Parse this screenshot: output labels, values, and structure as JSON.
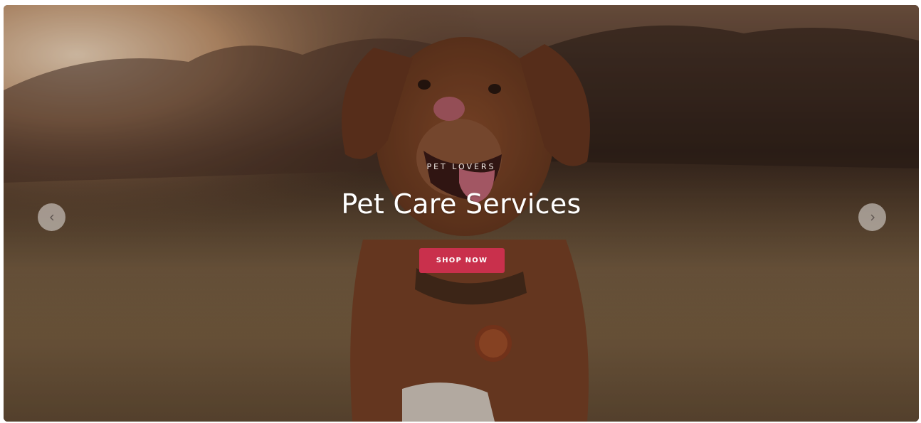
{
  "hero": {
    "eyebrow": "PET LOVERS",
    "title": "Pet Care Services",
    "cta_label": "SHOP NOW",
    "prev_icon": "chevron-left-icon",
    "next_icon": "chevron-right-icon"
  },
  "colors": {
    "cta": "#c9304c",
    "arrow_bg": "#d7d2cd",
    "text": "#ffffff"
  }
}
